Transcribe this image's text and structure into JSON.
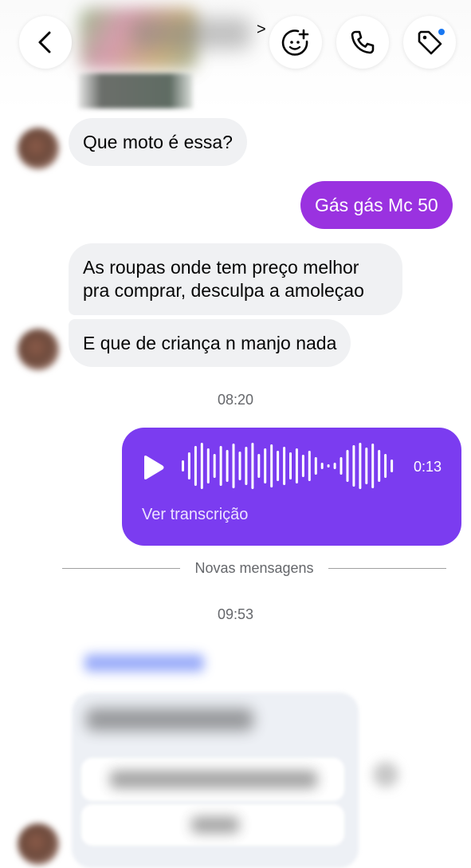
{
  "header": {
    "back_icon": "chevron-left-icon",
    "chevron_icon": "chevron-right-icon",
    "actions": [
      "sticker-plus-icon",
      "phone-icon",
      "tag-icon"
    ],
    "chevron_glyph": ">"
  },
  "messages": [
    {
      "from": "contact",
      "text": "Que moto é  essa?"
    },
    {
      "from": "me",
      "text": "Gás gás Mc 50"
    },
    {
      "from": "contact",
      "text": "As roupas onde tem preço  melhor\npra comprar, desculpa a amoleçao"
    },
    {
      "from": "contact",
      "text": "E que de criança n manjo nada"
    }
  ],
  "timestamps": [
    "08:20",
    "09:53"
  ],
  "voice_message": {
    "duration": "0:13",
    "transcript_link": "Ver transcrição",
    "play_icon": "play-icon"
  },
  "divider_label": "Novas mensagens",
  "colors": {
    "outgoing_bubble": "#9a32e0",
    "voice_bubble": "#7b3cf0",
    "incoming_bubble": "#f0f1f3",
    "notification_dot": "#1877f2"
  }
}
